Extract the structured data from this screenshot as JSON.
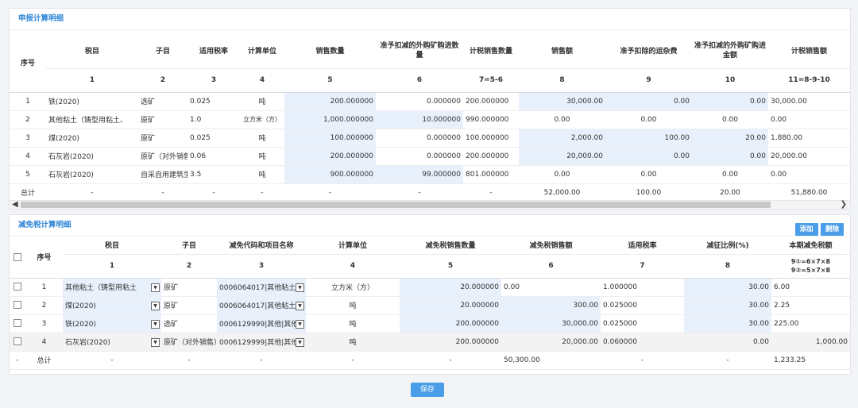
{
  "panel1": {
    "title": "申报计算明细",
    "headers": [
      "序号",
      "税目",
      "子目",
      "适用税率",
      "计算单位",
      "销售数量",
      "准予扣减的外购矿购进数量",
      "计税销售数量",
      "销售额",
      "准予扣除的运杂费",
      "准予扣减的外购矿购进金额",
      "计税销售额"
    ],
    "numbers": [
      "1",
      "2",
      "3",
      "4",
      "5",
      "6",
      "7=5-6",
      "8",
      "9",
      "10",
      "11=8-9-10"
    ],
    "rows": [
      [
        "1",
        "铁(2020)",
        "选矿",
        "0.025",
        "吨",
        "200.000000",
        "0.000000",
        "200.000000",
        "30,000.00",
        "0.00",
        "0.00",
        "30,000.00"
      ],
      [
        "2",
        "其他粘土（铸型用粘土、",
        "原矿",
        "1.0",
        "立方米（方）",
        "1,000.000000",
        "10.000000",
        "990.000000",
        "0.00",
        "0.00",
        "0.00",
        "0.00"
      ],
      [
        "3",
        "煤(2020)",
        "原矿",
        "0.025",
        "吨",
        "100.000000",
        "0.000000",
        "100.000000",
        "2,000.00",
        "100.00",
        "20.00",
        "1,880.00"
      ],
      [
        "4",
        "石灰岩(2020)",
        "原矿（对外销售",
        "0.06",
        "吨",
        "200.000000",
        "0.000000",
        "200.000000",
        "20,000.00",
        "0.00",
        "0.00",
        "20,000.00"
      ],
      [
        "5",
        "石灰岩(2020)",
        "自采自用建筑生",
        "3.5",
        "吨",
        "900.000000",
        "99.000000",
        "801.000000",
        "0.00",
        "0.00",
        "0.00",
        "0.00"
      ]
    ],
    "total": [
      "总计",
      "-",
      "-",
      "-",
      "-",
      "-",
      "-",
      "-",
      "52,000.00",
      "100.00",
      "20.00",
      "51,880.00"
    ]
  },
  "panel2": {
    "title": "减免税计算明细",
    "add_label": "添加",
    "delete_label": "删除",
    "headers": [
      "序号",
      "税目",
      "子目",
      "减免代码和项目名称",
      "计算单位",
      "减免税销售数量",
      "减免税销售额",
      "适用税率",
      "减征比例(%)",
      "本期减免税额"
    ],
    "numbers": [
      "1",
      "2",
      "3",
      "4",
      "5",
      "6",
      "7",
      "8"
    ],
    "last_num_a": "9①=6×7×8",
    "last_num_b": "9②=5×7×8",
    "rows": [
      [
        "1",
        "其他粘土（铸型用粘土",
        "原矿",
        "0006064017|其他粘土",
        "立方米（方）",
        "20.000000",
        "0.00",
        "1.000000",
        "30.00",
        "6.00"
      ],
      [
        "2",
        "煤(2020)",
        "原矿",
        "0006064017|其他粘土",
        "吨",
        "20.000000",
        "300.00",
        "0.025000",
        "30.00",
        "2.25"
      ],
      [
        "3",
        "铁(2020)",
        "选矿",
        "0006129999|其他|其他",
        "吨",
        "200.000000",
        "30,000.00",
        "0.025000",
        "30.00",
        "225.00"
      ],
      [
        "4",
        "石灰岩(2020)",
        "原矿（对外销售）",
        "0006129999|其他|其他",
        "吨",
        "200.000000",
        "20,000.00",
        "0.060000",
        "0.00",
        "1,000.00"
      ]
    ],
    "total": [
      "-",
      "总计",
      "-",
      "-",
      "-",
      "-",
      "-",
      "50,300.00",
      "-",
      "-",
      "1,233.25"
    ]
  },
  "save_label": "保存"
}
